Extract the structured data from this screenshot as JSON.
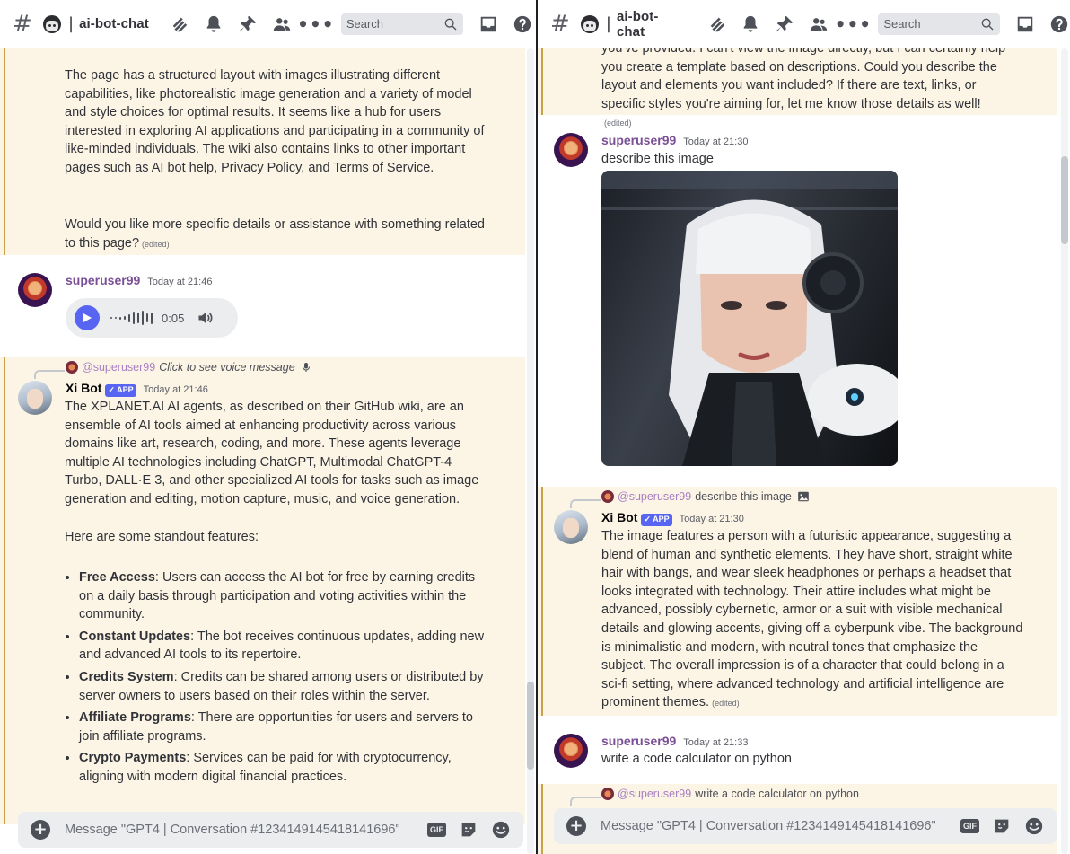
{
  "channel": {
    "name": "ai-bot-chat"
  },
  "search": {
    "placeholder": "Search"
  },
  "composer": {
    "placeholder": "Message \"GPT4 | Conversation #1234149145418141696\"",
    "gif_label": "GIF"
  },
  "left": {
    "bot_tail": {
      "paragraph1": "The page has a structured layout with images illustrating different capabilities, like photorealistic image generation and a variety of model and style choices for optimal results. It seems like a hub for users interested in exploring AI applications and participating in a community of like-minded individuals. The wiki also contains links to other important pages such as AI bot help, Privacy Policy, and Terms of Service.",
      "paragraph2": "Would you like more specific details or assistance with something related to this page?",
      "edited": "(edited)"
    },
    "user_voice": {
      "username": "superuser99",
      "timestamp": "Today at 21:46",
      "duration": "0:05"
    },
    "bot_reply": {
      "reply_mention": "@superuser99",
      "reply_text": "Click to see voice message",
      "bot_name": "Xi Bot",
      "badge": "✓ APP",
      "timestamp": "Today at 21:46",
      "intro": "The XPLANET.AI AI agents, as described on their GitHub wiki, are an ensemble of AI tools aimed at enhancing productivity across various domains like art, research, coding, and more. These agents leverage multiple AI technologies including ChatGPT, Multimodal ChatGPT-4 Turbo, DALL·E 3, and other specialized AI tools for tasks such as image generation and editing, motion capture, music, and voice generation.",
      "features_heading": "Here are some standout features:",
      "features": [
        {
          "title": "Free Access",
          "text": ": Users can access the AI bot for free by earning credits on a daily basis through participation and voting activities within the community."
        },
        {
          "title": "Constant Updates",
          "text": ": The bot receives continuous updates, adding new and advanced AI tools to its repertoire."
        },
        {
          "title": "Credits System",
          "text": ": Credits can be shared among users or distributed by server owners to users based on their roles within the server."
        },
        {
          "title": "Affiliate Programs",
          "text": ": There are opportunities for users and servers to join affiliate programs."
        },
        {
          "title": "Crypto Payments",
          "text": ": Services can be paid for with cryptocurrency, aligning with modern digital financial practices."
        }
      ]
    }
  },
  "right": {
    "bot_tail": {
      "text": "you've provided. I can't view the image directly, but I can certainly help you create a template based on descriptions. Could you describe the layout and elements you want included? If there are text, links, or specific styles you're aiming for, let me know those details as well!",
      "edited": "(edited)"
    },
    "user_image": {
      "username": "superuser99",
      "timestamp": "Today at 21:30",
      "text": "describe this image"
    },
    "bot_describe": {
      "reply_mention": "@superuser99",
      "reply_text": "describe this image",
      "bot_name": "Xi Bot",
      "badge": "✓ APP",
      "timestamp": "Today at 21:30",
      "text": "The image features a person with a futuristic appearance, suggesting a blend of human and synthetic elements. They have short, straight white hair with bangs, and wear sleek headphones or perhaps a headset that looks integrated with technology. Their attire includes what might be advanced, possibly cybernetic, armor or a suit with visible mechanical details and glowing accents, giving off a cyberpunk vibe. The background is minimalistic and modern, with neutral tones that emphasize the subject. The overall impression is of a character that could belong in a sci-fi setting, where advanced technology and artificial intelligence are prominent themes.",
      "edited": "(edited)"
    },
    "user_code": {
      "username": "superuser99",
      "timestamp": "Today at 21:33",
      "text": "write a code calculator on python"
    },
    "bot_pending": {
      "reply_mention": "@superuser99",
      "reply_text": "write a code calculator on python"
    }
  }
}
